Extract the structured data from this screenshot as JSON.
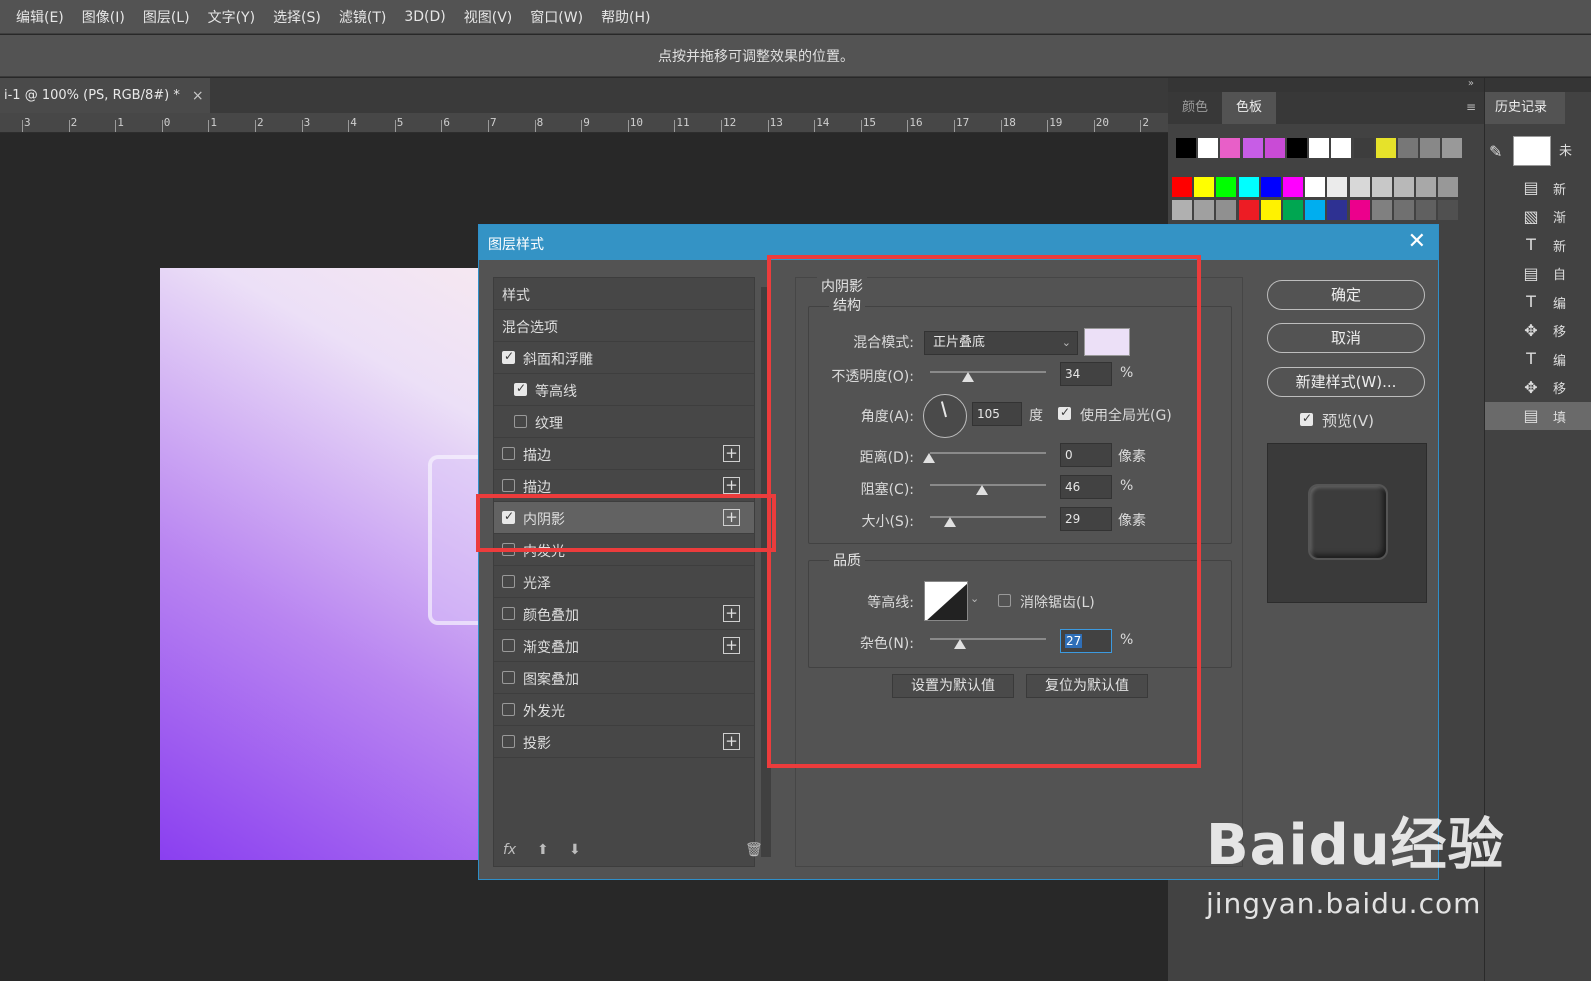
{
  "menu": [
    "编辑(E)",
    "图像(I)",
    "图层(L)",
    "文字(Y)",
    "选择(S)",
    "滤镜(T)",
    "3D(D)",
    "视图(V)",
    "窗口(W)",
    "帮助(H)"
  ],
  "options_hint": "点按并拖移可调整效果的位置。",
  "doc_tab": {
    "title": "i-1 @ 100% (PS, RGB/8#) *",
    "close": "×"
  },
  "ruler_ticks": [
    "3",
    "2",
    "1",
    "0",
    "1",
    "2",
    "3",
    "4",
    "5",
    "6",
    "7",
    "8",
    "9",
    "10",
    "11",
    "12",
    "13",
    "14",
    "15",
    "16",
    "17",
    "18",
    "19",
    "20",
    "2"
  ],
  "swatches_panel": {
    "tab_color": "颜色",
    "tab_swatches": "色板",
    "menu_icon": "≡",
    "collapse": "»"
  },
  "swatch_colors": {
    "row1": [
      "#000000",
      "#ffffff",
      "#e85fc8",
      "#c75de6",
      "#c94bd6",
      "#000000",
      "#ffffff",
      "#ffffff",
      "#3d3d3d",
      "#e6e22a",
      "#777777",
      "#888888",
      "#999999"
    ],
    "row2": [
      "#ff0000",
      "#ffff00",
      "#00ff00",
      "#00ffff",
      "#0000ff",
      "#ff00ff",
      "#ffffff",
      "#ebebeb",
      "#d8d8d8",
      "#c8c8c8",
      "#b8b8b8",
      "#a8a8a8",
      "#989898"
    ],
    "row3": [
      "#b0b0b0",
      "#a0a0a0",
      "#909090",
      "#ed1c24",
      "#fff200",
      "#00a651",
      "#00aeef",
      "#2e3192",
      "#ec008c",
      "#808080",
      "#707070",
      "#606060",
      "#505050"
    ]
  },
  "history_panel": {
    "tab": "历史记录",
    "snapshot_label": "未",
    "items": [
      {
        "icon": "document-icon",
        "glyph": "▤",
        "label": "新"
      },
      {
        "icon": "gradient-icon",
        "glyph": "▧",
        "label": "渐"
      },
      {
        "icon": "type-tool-icon",
        "glyph": "T",
        "label": "新"
      },
      {
        "icon": "document-icon",
        "glyph": "▤",
        "label": "自"
      },
      {
        "icon": "type-tool-icon",
        "glyph": "T",
        "label": "编"
      },
      {
        "icon": "move-tool-icon",
        "glyph": "✥",
        "label": "移"
      },
      {
        "icon": "type-tool-icon",
        "glyph": "T",
        "label": "编"
      },
      {
        "icon": "move-tool-icon",
        "glyph": "✥",
        "label": "移"
      },
      {
        "icon": "document-icon",
        "glyph": "▤",
        "label": "填"
      }
    ]
  },
  "dialog": {
    "title": "图层样式",
    "close": "✕",
    "styles_header": "样式",
    "blend_options": "混合选项",
    "list": [
      {
        "label": "斜面和浮雕",
        "checked": true,
        "plus": false,
        "indent": false
      },
      {
        "label": "等高线",
        "checked": true,
        "plus": false,
        "indent": true
      },
      {
        "label": "纹理",
        "checked": false,
        "plus": false,
        "indent": true
      },
      {
        "label": "描边",
        "checked": false,
        "plus": true,
        "indent": false
      },
      {
        "label": "描边",
        "checked": false,
        "plus": true,
        "indent": false
      },
      {
        "label": "内阴影",
        "checked": true,
        "plus": true,
        "indent": false,
        "selected": true
      },
      {
        "label": "内发光",
        "checked": false,
        "plus": false,
        "indent": false
      },
      {
        "label": "光泽",
        "checked": false,
        "plus": false,
        "indent": false
      },
      {
        "label": "颜色叠加",
        "checked": false,
        "plus": true,
        "indent": false
      },
      {
        "label": "渐变叠加",
        "checked": false,
        "plus": true,
        "indent": false
      },
      {
        "label": "图案叠加",
        "checked": false,
        "plus": false,
        "indent": false
      },
      {
        "label": "外发光",
        "checked": false,
        "plus": false,
        "indent": false
      },
      {
        "label": "投影",
        "checked": false,
        "plus": true,
        "indent": false
      }
    ],
    "list_footer": {
      "fx": "fx",
      "up": "⬆",
      "down": "⬇",
      "trash": "🗑"
    },
    "section_title": "内阴影",
    "structure": {
      "title": "结构",
      "blend_mode_label": "混合模式:",
      "blend_mode_value": "正片叠底",
      "color": "#ece0f7",
      "opacity_label": "不透明度(O):",
      "opacity_value": "34",
      "opacity_unit": "%",
      "angle_label": "角度(A):",
      "angle_value": "105",
      "angle_unit": "度",
      "global_light_label": "使用全局光(G)",
      "global_light_checked": true,
      "distance_label": "距离(D):",
      "distance_value": "0",
      "distance_unit": "像素",
      "choke_label": "阻塞(C):",
      "choke_value": "46",
      "choke_unit": "%",
      "size_label": "大小(S):",
      "size_value": "29",
      "size_unit": "像素"
    },
    "quality": {
      "title": "品质",
      "contour_label": "等高线:",
      "antialias_label": "消除锯齿(L)",
      "antialias_checked": false,
      "noise_label": "杂色(N):",
      "noise_value": "27",
      "noise_unit": "%"
    },
    "make_default": "设置为默认值",
    "reset_default": "复位为默认值",
    "ok": "确定",
    "cancel": "取消",
    "new_style": "新建样式(W)...",
    "preview_label": "预览(V)",
    "preview_checked": true
  },
  "watermark": {
    "brand": "Baidu经验",
    "url": "jingyan.baidu.com"
  }
}
